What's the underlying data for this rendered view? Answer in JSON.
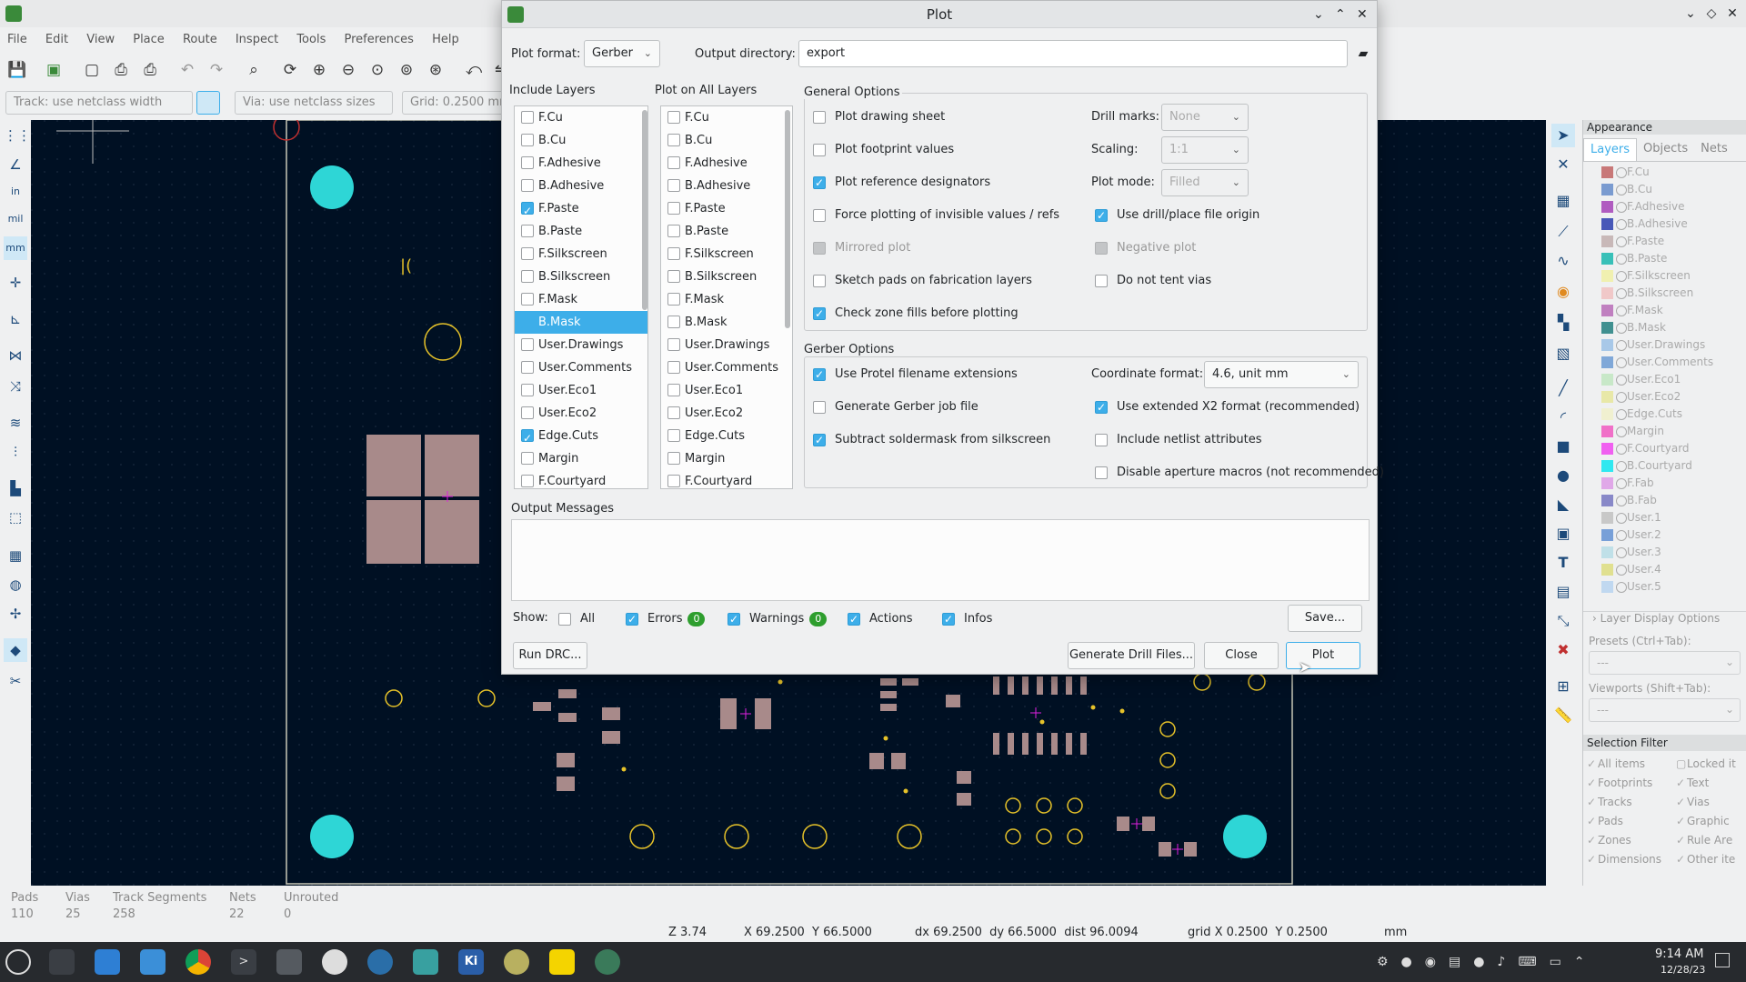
{
  "app": {
    "menu": [
      "File",
      "Edit",
      "View",
      "Place",
      "Route",
      "Inspect",
      "Tools",
      "Preferences",
      "Help"
    ],
    "track_select": "Track: use netclass width",
    "via_select": "Via: use netclass sizes",
    "grid_select": "Grid: 0.2500 mm"
  },
  "dialog": {
    "title": "Plot",
    "plot_format_label": "Plot format:",
    "plot_format": "Gerber",
    "output_dir_label": "Output directory:",
    "output_dir": "export",
    "include_layers_title": "Include Layers",
    "include_layers": [
      {
        "name": "F.Cu",
        "checked": false
      },
      {
        "name": "B.Cu",
        "checked": false
      },
      {
        "name": "F.Adhesive",
        "checked": false
      },
      {
        "name": "B.Adhesive",
        "checked": false
      },
      {
        "name": "F.Paste",
        "checked": true
      },
      {
        "name": "B.Paste",
        "checked": false
      },
      {
        "name": "F.Silkscreen",
        "checked": false
      },
      {
        "name": "B.Silkscreen",
        "checked": false
      },
      {
        "name": "F.Mask",
        "checked": false
      },
      {
        "name": "B.Mask",
        "checked": false,
        "selected": true
      },
      {
        "name": "User.Drawings",
        "checked": false
      },
      {
        "name": "User.Comments",
        "checked": false
      },
      {
        "name": "User.Eco1",
        "checked": false
      },
      {
        "name": "User.Eco2",
        "checked": false
      },
      {
        "name": "Edge.Cuts",
        "checked": true
      },
      {
        "name": "Margin",
        "checked": false
      },
      {
        "name": "F.Courtyard",
        "checked": false
      }
    ],
    "plot_all_title": "Plot on All Layers",
    "plot_all_layers": [
      "F.Cu",
      "B.Cu",
      "F.Adhesive",
      "B.Adhesive",
      "F.Paste",
      "B.Paste",
      "F.Silkscreen",
      "B.Silkscreen",
      "F.Mask",
      "B.Mask",
      "User.Drawings",
      "User.Comments",
      "User.Eco1",
      "User.Eco2",
      "Edge.Cuts",
      "Margin",
      "F.Courtyard"
    ],
    "general_title": "General Options",
    "general_left": [
      {
        "label": "Plot drawing sheet",
        "checked": false
      },
      {
        "label": "Plot footprint values",
        "checked": false
      },
      {
        "label": "Plot reference designators",
        "checked": true
      },
      {
        "label": "Force plotting of invisible values / refs",
        "checked": false
      },
      {
        "label": "Mirrored plot",
        "checked": false,
        "disabled": true
      },
      {
        "label": "Sketch pads on fabrication layers",
        "checked": false
      },
      {
        "label": "Check zone fills before plotting",
        "checked": true
      }
    ],
    "drill_marks_label": "Drill marks:",
    "drill_marks": "None",
    "scaling_label": "Scaling:",
    "scaling": "1:1",
    "plot_mode_label": "Plot mode:",
    "plot_mode": "Filled",
    "general_right": [
      {
        "label": "Use drill/place file origin",
        "checked": true
      },
      {
        "label": "Negative plot",
        "checked": false,
        "disabled": true
      },
      {
        "label": "Do not tent vias",
        "checked": false
      }
    ],
    "gerber_title": "Gerber Options",
    "gerber_left": [
      {
        "label": "Use Protel filename extensions",
        "checked": true
      },
      {
        "label": "Generate Gerber job file",
        "checked": false
      },
      {
        "label": "Subtract soldermask from silkscreen",
        "checked": true
      }
    ],
    "coord_format_label": "Coordinate format:",
    "coord_format": "4.6, unit mm",
    "gerber_right": [
      {
        "label": "Use extended X2 format (recommended)",
        "checked": true
      },
      {
        "label": "Include netlist attributes",
        "checked": false
      },
      {
        "label": "Disable aperture macros (not recommended)",
        "checked": false
      }
    ],
    "output_messages_title": "Output Messages",
    "show_label": "Show:",
    "filters": {
      "all": "All",
      "errors": "Errors",
      "errors_count": "0",
      "warnings": "Warnings",
      "warnings_count": "0",
      "actions": "Actions",
      "infos": "Infos"
    },
    "save_button": "Save...",
    "run_drc_button": "Run DRC...",
    "drill_button": "Generate Drill Files...",
    "close_button": "Close",
    "plot_button": "Plot"
  },
  "appearance": {
    "title": "Appearance",
    "tabs": [
      "Layers",
      "Objects",
      "Nets"
    ],
    "layers": [
      {
        "name": "F.Cu",
        "color": "#c87878"
      },
      {
        "name": "B.Cu",
        "color": "#7a9bd0"
      },
      {
        "name": "F.Adhesive",
        "color": "#b05cc0"
      },
      {
        "name": "B.Adhesive",
        "color": "#4858b8"
      },
      {
        "name": "F.Paste",
        "color": "#c8b8b8"
      },
      {
        "name": "B.Paste",
        "color": "#38c0b8"
      },
      {
        "name": "F.Silkscreen",
        "color": "#f0f0b0"
      },
      {
        "name": "B.Silkscreen",
        "color": "#f0c8c8"
      },
      {
        "name": "F.Mask",
        "color": "#c080c0"
      },
      {
        "name": "B.Mask",
        "color": "#409090"
      },
      {
        "name": "User.Drawings",
        "color": "#a8c8e8"
      },
      {
        "name": "User.Comments",
        "color": "#80a8d8"
      },
      {
        "name": "User.Eco1",
        "color": "#c8e8c8"
      },
      {
        "name": "User.Eco2",
        "color": "#e8e8a8"
      },
      {
        "name": "Edge.Cuts",
        "color": "#f0f0d0"
      },
      {
        "name": "Margin",
        "color": "#f070c8"
      },
      {
        "name": "F.Courtyard",
        "color": "#f060f0"
      },
      {
        "name": "B.Courtyard",
        "color": "#30e8f0"
      },
      {
        "name": "F.Fab",
        "color": "#e0a8e8"
      },
      {
        "name": "B.Fab",
        "color": "#8888c8"
      },
      {
        "name": "User.1",
        "color": "#c8c8c8"
      },
      {
        "name": "User.2",
        "color": "#78a0d8"
      },
      {
        "name": "User.3",
        "color": "#c0e0e8"
      },
      {
        "name": "User.4",
        "color": "#e0e090"
      },
      {
        "name": "User.5",
        "color": "#c0d8f0"
      }
    ],
    "layer_display_options": "Layer Display Options",
    "presets_label": "Presets (Ctrl+Tab):",
    "presets_value": "---",
    "viewports_label": "Viewports (Shift+Tab):",
    "viewports_value": "---",
    "selection_filter_title": "Selection Filter",
    "filter_left": [
      "All items",
      "Footprints",
      "Tracks",
      "Pads",
      "Zones",
      "Dimensions"
    ],
    "filter_right": [
      "Locked it",
      "Text",
      "Vias",
      "Graphic",
      "Rule Are",
      "Other ite"
    ]
  },
  "status": {
    "headers": [
      "Pads",
      "Vias",
      "Track Segments",
      "Nets",
      "Unrouted"
    ],
    "values": [
      "110",
      "25",
      "258",
      "22",
      "0"
    ],
    "zoom": "Z 3.74",
    "coords": "X 69.2500  Y 66.5000",
    "delta": "dx 69.2500  dy 66.5000  dist 96.0094",
    "grid": "grid X 0.2500  Y 0.2500",
    "units": "mm"
  },
  "taskbar": {
    "time": "9:14 AM",
    "date": "12/28/23"
  },
  "colors": {
    "canvas": "#001023",
    "accent": "#3daee9",
    "via": "#2ed6d6",
    "pad": "#a88a8a",
    "hole": "#e6c229"
  }
}
